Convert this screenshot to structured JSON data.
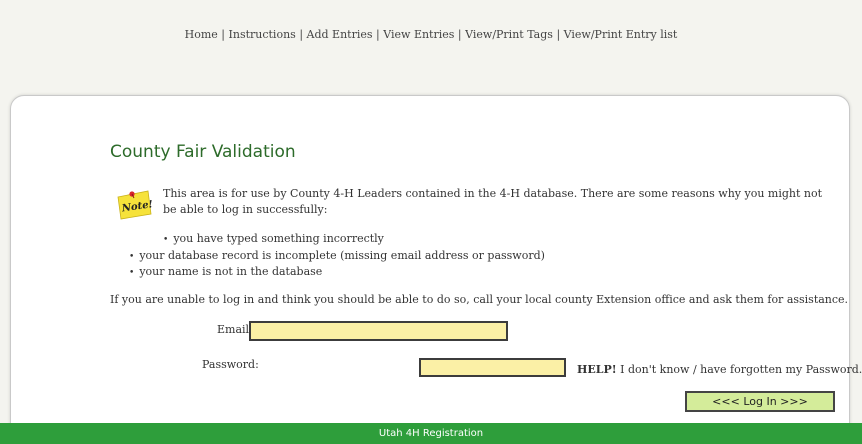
{
  "nav": {
    "items": [
      "Home",
      "Instructions",
      "Add Entries",
      "View Entries",
      "View/Print Tags",
      "View/Print Entry list"
    ],
    "separator": "|"
  },
  "page": {
    "title": "County Fair Validation",
    "note_icon": "note-sticky-icon",
    "note_icon_text": "Note!",
    "intro": "This area is for use by County 4-H Leaders contained in the 4-H database. There are some reasons why you might not be able to log in successfully:",
    "reasons": [
      "you have typed something incorrectly",
      "your database record is incomplete (missing email address or password)",
      "your name is not in the database"
    ],
    "assist": "If you are unable to log in and think you should be able to do so, call your local county Extension office and ask them for assistance."
  },
  "form": {
    "email_label": "Email:",
    "email_value": "",
    "password_label": "Password:",
    "password_value": "",
    "help_bold": "HELP!",
    "help_text": " I don't know / have forgotten my Password...",
    "login_label": "<<< Log In >>>"
  },
  "colors": {
    "title": "#2d6b2a",
    "field_bg": "#fbf0a6",
    "button_bg": "#d4ec9a",
    "footer_bg": "#2e9e3b"
  },
  "footer": {
    "text": "Utah 4H Registration"
  }
}
